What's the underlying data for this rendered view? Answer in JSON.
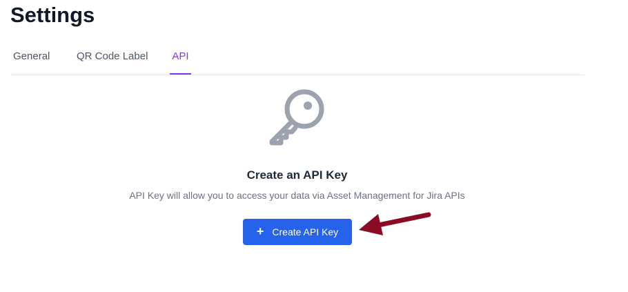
{
  "page": {
    "title": "Settings"
  },
  "tabs": [
    {
      "label": "General",
      "active": false
    },
    {
      "label": "QR Code Label",
      "active": false
    },
    {
      "label": "API",
      "active": true
    }
  ],
  "empty_state": {
    "icon": "key-icon",
    "heading": "Create an API Key",
    "description": "API Key will allow you to access your data via Asset Management for Jira APIs",
    "button_icon": "plus",
    "button_label": "Create API Key"
  },
  "annotation": {
    "icon": "arrow-left-icon",
    "color": "#8b0a24"
  },
  "colors": {
    "accent": "#7c3aed",
    "primary_button": "#2563eb",
    "icon_gray": "#9ca3af"
  }
}
